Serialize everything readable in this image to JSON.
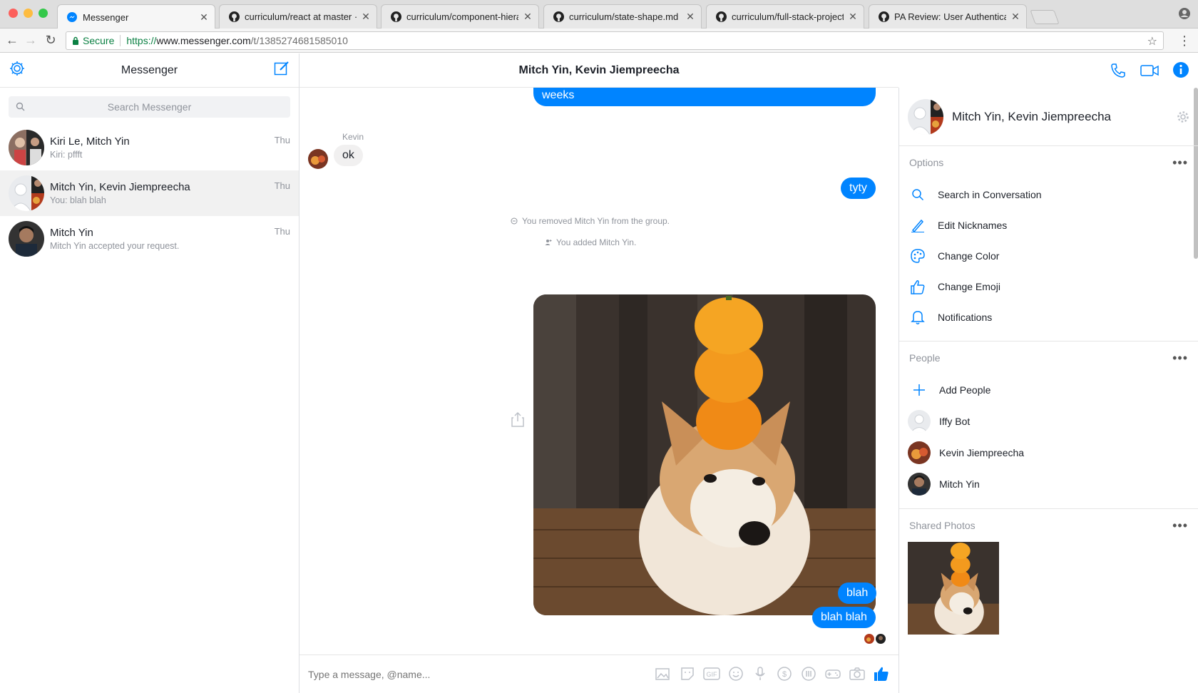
{
  "browser": {
    "tabs": [
      {
        "title": "Messenger",
        "icon": "messenger-icon",
        "active": true
      },
      {
        "title": "curriculum/react at master · ap",
        "icon": "github-icon"
      },
      {
        "title": "curriculum/component-hierarc",
        "icon": "github-icon"
      },
      {
        "title": "curriculum/state-shape.md at",
        "icon": "github-icon"
      },
      {
        "title": "curriculum/full-stack-project-p",
        "icon": "github-icon"
      },
      {
        "title": "PA Review: User Authenticatio",
        "icon": "github-icon"
      }
    ],
    "secure_label": "Secure",
    "url_scheme": "https://",
    "url_host": "www.messenger.com",
    "url_path": "/t/1385274681585010"
  },
  "sidebar": {
    "title": "Messenger",
    "search_placeholder": "Search Messenger",
    "conversations": [
      {
        "name": "Kiri Le, Mitch Yin",
        "preview": "Kiri: pffft",
        "time": "Thu"
      },
      {
        "name": "Mitch Yin, Kevin Jiempreecha",
        "preview": "You: blah blah",
        "time": "Thu",
        "selected": true
      },
      {
        "name": "Mitch Yin",
        "preview": "Mitch Yin accepted your request.",
        "time": "Thu"
      }
    ]
  },
  "thread": {
    "title": "Mitch Yin, Kevin Jiempreecha",
    "messages": {
      "partial_top": "weeks",
      "sender_label": "Kevin",
      "incoming_ok": "ok",
      "out_tyty": "tyty",
      "sys_removed": "You removed Mitch Yin from the group.",
      "sys_added": "You added Mitch Yin.",
      "out_blah": "blah",
      "out_blahblah": "blah blah"
    },
    "composer_placeholder": "Type a message, @name..."
  },
  "details": {
    "name": "Mitch Yin, Kevin Jiempreecha",
    "options_label": "Options",
    "options": [
      {
        "label": "Search in Conversation",
        "icon": "search-icon"
      },
      {
        "label": "Edit Nicknames",
        "icon": "pencil-icon"
      },
      {
        "label": "Change Color",
        "icon": "palette-icon"
      },
      {
        "label": "Change Emoji",
        "icon": "thumbs-up-icon"
      },
      {
        "label": "Notifications",
        "icon": "bell-icon"
      }
    ],
    "people_label": "People",
    "add_people": "Add People",
    "people": [
      "Iffy Bot",
      "Kevin Jiempreecha",
      "Mitch Yin"
    ],
    "shared_photos_label": "Shared Photos"
  },
  "colors": {
    "accent": "#0084ff",
    "bubble_in": "#f1f0f0",
    "muted": "#90949c"
  }
}
